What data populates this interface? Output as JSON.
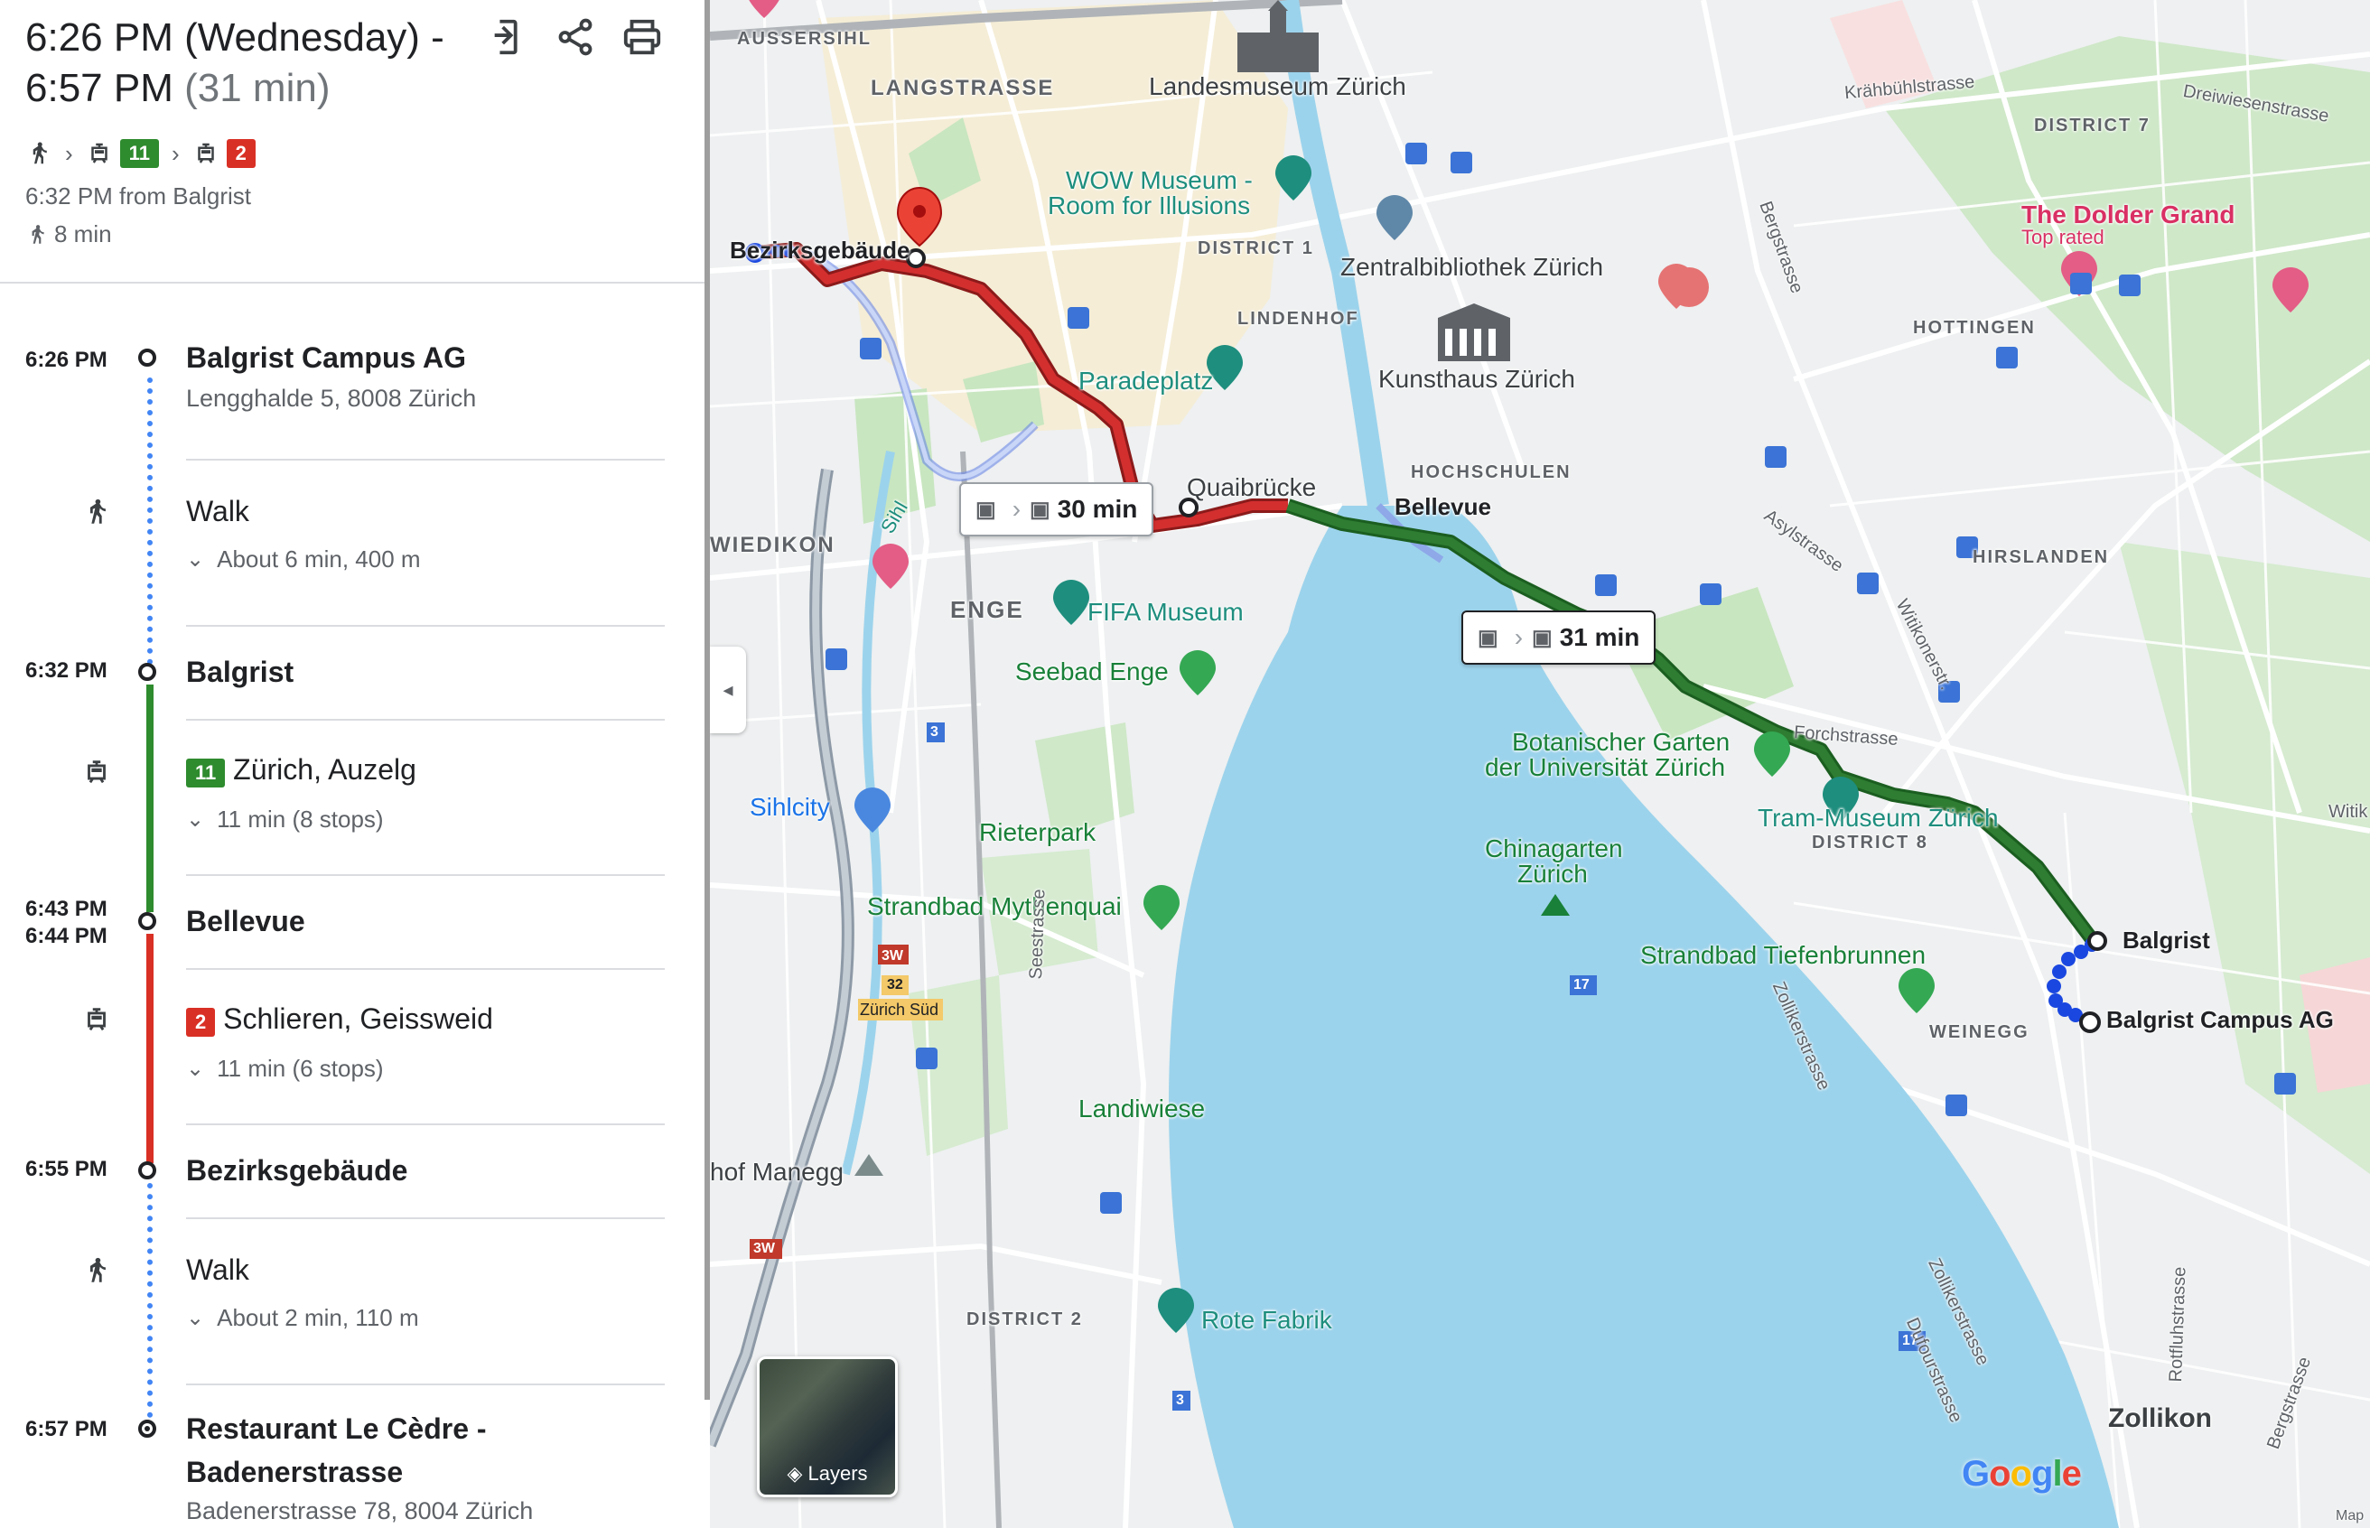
{
  "header": {
    "title_line1": "6:26 PM (Wednesday) -",
    "title_line2": "6:57 PM",
    "duration": "(31 min)",
    "icons": [
      "send-to-phone-icon",
      "share-icon",
      "print-icon"
    ]
  },
  "summary": {
    "tram_line_1": "11",
    "tram_line_2": "2",
    "departure": "6:32 PM from Balgrist",
    "walk_total": "8 min"
  },
  "itinerary": {
    "stops": [
      {
        "time": "6:26 PM",
        "name": "Balgrist Campus AG",
        "address": "Lengghalde 5, 8008 Zürich"
      },
      {
        "time": "6:32 PM",
        "name": "Balgrist"
      },
      {
        "time": "6:43 PM",
        "time2": "6:44 PM",
        "name": "Bellevue"
      },
      {
        "time": "6:55 PM",
        "name": "Bezirksgebäude"
      },
      {
        "time": "6:57 PM",
        "name": "Restaurant Le Cèdre -",
        "name2": "Badenerstrasse",
        "address": "Badenerstrasse 78, 8004 Zürich"
      }
    ],
    "steps": [
      {
        "mode": "walk",
        "main": "Walk",
        "sub": "About 6 min, 400 m"
      },
      {
        "mode": "tram",
        "line": "11",
        "line_color": "#2e8b2e",
        "main": "Zürich, Auzelg",
        "sub": "11 min (8 stops)"
      },
      {
        "mode": "tram",
        "line": "2",
        "line_color": "#d93025",
        "main": "Schlieren, Geissweid",
        "sub": "11 min (6 stops)"
      },
      {
        "mode": "walk",
        "main": "Walk",
        "sub": "About 2 min, 110 m"
      }
    ]
  },
  "map": {
    "route_boxes": [
      {
        "duration": "30 min"
      },
      {
        "duration": "31 min"
      }
    ],
    "labels": {
      "aussersihl": "AUSSERSIHL",
      "langstrasse": "LANGSTRASSE",
      "landesmuseum": "Landesmuseum Zürich",
      "wow_museum": "WOW Museum -",
      "wow_museum2": "Room for Illusions",
      "district1": "DISTRICT 1",
      "zentralbibliothek": "Zentralbibliothek Zürich",
      "lindenhof": "LINDENHOF",
      "kunsthaus": "Kunsthaus Zürich",
      "paradeplatz": "Paradeplatz",
      "quaibruecke": "Quaibrücke",
      "bellevue": "Bellevue",
      "hochschulen": "HOCHSCHULEN",
      "wiedikon": "WIEDIKON",
      "sihl": "Sihl",
      "enge": "ENGE",
      "fifa": "FIFA Museum",
      "seebad": "Seebad Enge",
      "sihlcity": "Sihlcity",
      "rieterpark": "Rieterpark",
      "strandbad_myth": "Strandbad Mythenquai",
      "zuerich_sued": "Zürich Süd",
      "seestrasse": "Seestrasse",
      "landiwiese": "Landiwiese",
      "hof_manegg": "hof Manegg",
      "district2": "DISTRICT 2",
      "rote_fabrik": "Rote Fabrik",
      "bezirksgebaeude": "Bezirksgebäude",
      "kraehbuehl": "Krähbühlstrasse",
      "district7": "DISTRICT 7",
      "dreiwiesen": "Dreiwiesenstrasse",
      "dolder": "The Dolder Grand",
      "dolder_sub": "Top rated",
      "hottingen": "HOTTINGEN",
      "bergstrasse": "Bergstrasse",
      "asylstrasse": "Asylstrasse",
      "hirslanden": "HIRSLANDEN",
      "witikoner": "Witikonerstr.",
      "forchstrasse": "Forchstrasse",
      "botanischer": "Botanischer Garten",
      "botanischer2": "der Universität Zürich",
      "tram_museum": "Tram-Museum Zürich",
      "district8": "DISTRICT 8",
      "chinagarten": "Chinagarten",
      "chinagarten2": "Zürich",
      "strandbad_tief": "Strandbad Tiefenbrunnen",
      "balgrist": "Balgrist",
      "balgrist_campus": "Balgrist Campus AG",
      "weinegg": "WEINEGG",
      "zollikerstrasse": "Zollikerstrasse",
      "zollikerstrasse2": "Zollikerstrasse",
      "dufourstrasse": "Dufourstrasse",
      "rotfluhstrasse": "Rotfluhstrasse",
      "bergstrasse2": "Bergstrasse",
      "zollikon": "Zollikon",
      "witik_edge": "Witik",
      "route_3w": "3W",
      "route_32": "32",
      "route_17": "17",
      "route_3": "3",
      "map_edge": "Map"
    },
    "layers_label": "Layers",
    "google_logo": "Google",
    "colors": {
      "water": "#9cd3ec",
      "park": "#c8e6c0",
      "tram_11": "#2e7d32",
      "tram_2": "#c62828",
      "walk": "#1a47e0",
      "alt_route": "#8ea8e8"
    }
  }
}
